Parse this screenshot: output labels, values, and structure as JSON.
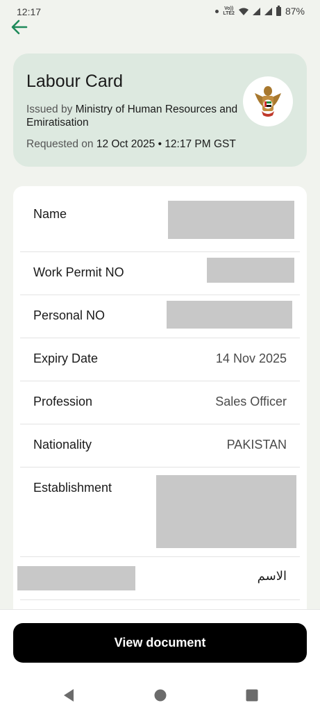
{
  "status_bar": {
    "time": "12:17",
    "network_label": "Vo))\nLTE2",
    "battery": "87%"
  },
  "header": {
    "title": "Labour Card",
    "issued_prefix": "Issued by ",
    "issuer": "Ministry of Human Resources and Emiratisation",
    "requested_prefix": "Requested on ",
    "requested_value": "12 Oct 2025 • 12:17 PM GST",
    "emblem_icon": "uae-emblem-icon"
  },
  "details": {
    "rows": [
      {
        "label": "Name",
        "value": "",
        "redacted": true
      },
      {
        "label": "Work Permit NO",
        "value": "",
        "redacted": true
      },
      {
        "label": "Personal NO",
        "value": "",
        "redacted": true
      },
      {
        "label": "Expiry Date",
        "value": "14 Nov 2025",
        "redacted": false
      },
      {
        "label": "Profession",
        "value": "Sales Officer",
        "redacted": false
      },
      {
        "label": "Nationality",
        "value": "PAKISTAN",
        "redacted": false
      },
      {
        "label": "Establishment",
        "value": "",
        "redacted": true
      },
      {
        "label": "الاسم",
        "value": "",
        "redacted": true
      }
    ]
  },
  "actions": {
    "view_document": "View document"
  },
  "nav": {
    "back_icon": "triangle-back-icon",
    "home_icon": "circle-home-icon",
    "recents_icon": "square-recents-icon"
  },
  "colors": {
    "accent": "#1e8a5a",
    "header_bg": "#dde9e0",
    "button_bg": "#000000",
    "redaction": "#c8c8c8"
  }
}
